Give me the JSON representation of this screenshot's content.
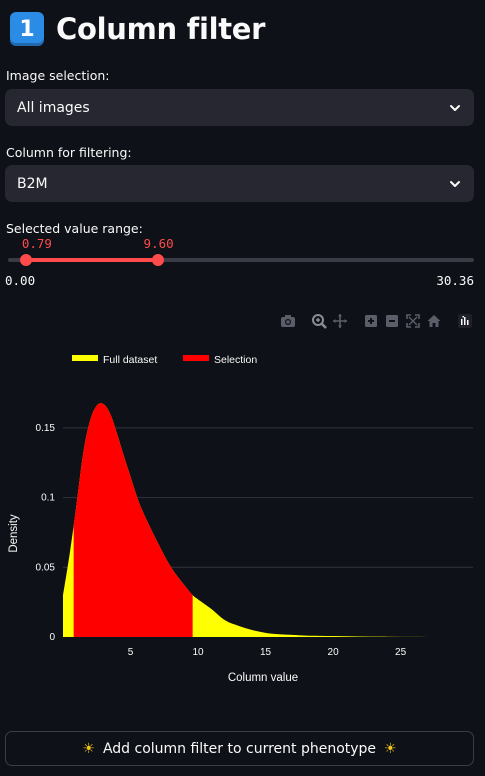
{
  "header": {
    "number_badge": "1",
    "title": "Column filter"
  },
  "image_selection": {
    "label": "Image selection:",
    "value": "All images"
  },
  "column_filter": {
    "label": "Column for filtering:",
    "value": "B2M"
  },
  "range": {
    "label": "Selected value range:",
    "low": 0.79,
    "high": 9.6,
    "low_text": "0.79",
    "high_text": "9.60",
    "min_text": "0.00",
    "max_text": "30.36",
    "min": 0,
    "max": 30.36
  },
  "toolbar_icons": [
    "camera-icon",
    "zoom-icon",
    "pan-icon",
    "zoom-in-icon",
    "zoom-out-icon",
    "autoscale-icon",
    "reset-axes-icon",
    "plotly-logo-icon"
  ],
  "colors": {
    "accent": "#ff4b4b",
    "full": "#ffff00",
    "selection": "#ff0000",
    "badge": "#2b8ce6"
  },
  "chart_data": {
    "type": "area",
    "xlabel": "Column value",
    "ylabel": "Density",
    "xlim": [
      0,
      30.36
    ],
    "ylim": [
      0,
      0.17
    ],
    "x_ticks": [
      5,
      10,
      15,
      20,
      25
    ],
    "y_ticks": [
      0,
      0.05,
      0.1,
      0.15
    ],
    "y_tick_labels": [
      "0",
      "0.05",
      "0.1",
      "0.15"
    ],
    "legend": [
      {
        "name": "Full dataset",
        "color": "#ffff00"
      },
      {
        "name": "Selection",
        "color": "#ff0000"
      }
    ],
    "legend_position": "top-left",
    "grid": true,
    "selection_range": [
      0.79,
      9.6
    ],
    "series": [
      {
        "name": "Full dataset",
        "x": [
          0.0,
          0.5,
          1.0,
          1.5,
          2.0,
          2.5,
          3.0,
          3.5,
          4.0,
          4.5,
          5.0,
          5.5,
          6.0,
          7.0,
          8.0,
          9.0,
          9.6,
          10.0,
          11.0,
          12.0,
          13.0,
          14.0,
          15.0,
          16.0,
          17.0,
          18.0,
          20.0,
          22.0,
          24.0,
          26.0,
          28.0,
          30.36
        ],
        "y": [
          0.03,
          0.06,
          0.095,
          0.132,
          0.155,
          0.166,
          0.167,
          0.16,
          0.146,
          0.13,
          0.115,
          0.1,
          0.088,
          0.068,
          0.05,
          0.037,
          0.03,
          0.027,
          0.02,
          0.012,
          0.008,
          0.005,
          0.003,
          0.002,
          0.0015,
          0.001,
          0.0007,
          0.0004,
          0.0002,
          0.0001,
          0.0,
          0.0
        ]
      }
    ]
  },
  "button": {
    "label": "Add column filter to current phenotype",
    "icon": "sun-icon"
  }
}
